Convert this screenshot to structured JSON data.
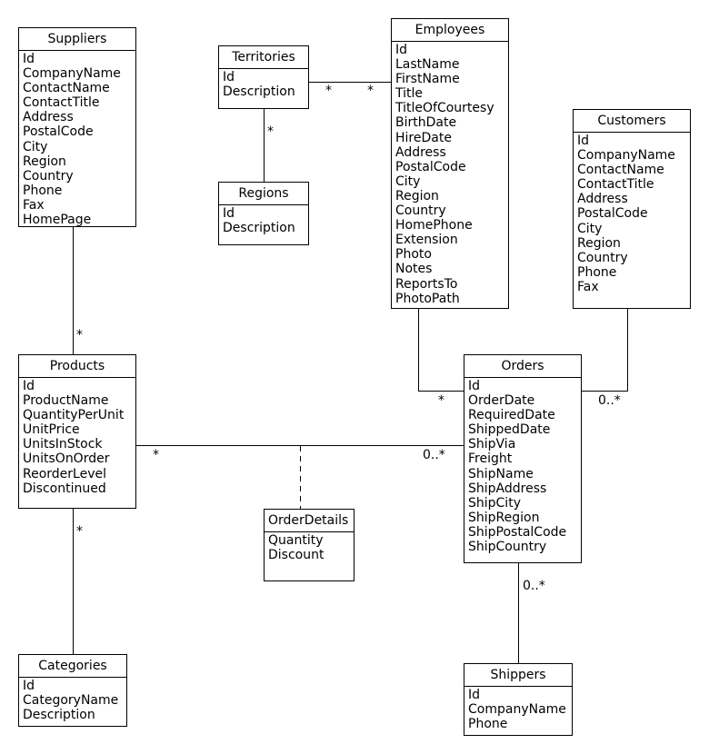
{
  "entities": [
    {
      "id": "suppliers",
      "name": "Suppliers",
      "attributes": [
        "Id",
        "CompanyName",
        "ContactName",
        "ContactTitle",
        "Address",
        "PostalCode",
        "City",
        "Region",
        "Country",
        "Phone",
        "Fax",
        "HomePage"
      ]
    },
    {
      "id": "territories",
      "name": "Territories",
      "attributes": [
        "Id",
        "Description"
      ]
    },
    {
      "id": "employees",
      "name": "Employees",
      "attributes": [
        "Id",
        "LastName",
        "FirstName",
        "Title",
        "TitleOfCourtesy",
        "BirthDate",
        "HireDate",
        "Address",
        "PostalCode",
        "City",
        "Region",
        "Country",
        "HomePhone",
        "Extension",
        "Photo",
        "Notes",
        "ReportsTo",
        "PhotoPath"
      ]
    },
    {
      "id": "customers",
      "name": "Customers",
      "attributes": [
        "Id",
        "CompanyName",
        "ContactName",
        "ContactTitle",
        "Address",
        "PostalCode",
        "City",
        "Region",
        "Country",
        "Phone",
        "Fax"
      ]
    },
    {
      "id": "regions",
      "name": "Regions",
      "attributes": [
        "Id",
        "Description"
      ]
    },
    {
      "id": "products",
      "name": "Products",
      "attributes": [
        "Id",
        "ProductName",
        "QuantityPerUnit",
        "UnitPrice",
        "UnitsInStock",
        "UnitsOnOrder",
        "ReorderLevel",
        "Discontinued"
      ]
    },
    {
      "id": "orders",
      "name": "Orders",
      "attributes": [
        "Id",
        "OrderDate",
        "RequiredDate",
        "ShippedDate",
        "ShipVia",
        "Freight",
        "ShipName",
        "ShipAddress",
        "ShipCity",
        "ShipRegion",
        "ShipPostalCode",
        "ShipCountry"
      ]
    },
    {
      "id": "orderdetails",
      "name": "OrderDetails",
      "attributes": [
        "Quantity",
        "Discount"
      ]
    },
    {
      "id": "categories",
      "name": "Categories",
      "attributes": [
        "Id",
        "CategoryName",
        "Description"
      ]
    },
    {
      "id": "shippers",
      "name": "Shippers",
      "attributes": [
        "Id",
        "CompanyName",
        "Phone"
      ]
    }
  ],
  "relationships": [
    {
      "from": "Suppliers",
      "to": "Products",
      "from_mult": "",
      "to_mult": "*"
    },
    {
      "from": "Territories",
      "to": "Employees",
      "from_mult": "*",
      "to_mult": "*"
    },
    {
      "from": "Territories",
      "to": "Regions",
      "from_mult": "*",
      "to_mult": ""
    },
    {
      "from": "Employees",
      "to": "Orders",
      "from_mult": "",
      "to_mult": "*"
    },
    {
      "from": "Customers",
      "to": "Orders",
      "from_mult": "",
      "to_mult": "0..*"
    },
    {
      "from": "Products",
      "to": "Orders",
      "from_mult": "*",
      "to_mult": "0..*",
      "association_class": "OrderDetails"
    },
    {
      "from": "Products",
      "to": "Categories",
      "from_mult": "*",
      "to_mult": ""
    },
    {
      "from": "Orders",
      "to": "Shippers",
      "from_mult": "0..*",
      "to_mult": ""
    }
  ]
}
